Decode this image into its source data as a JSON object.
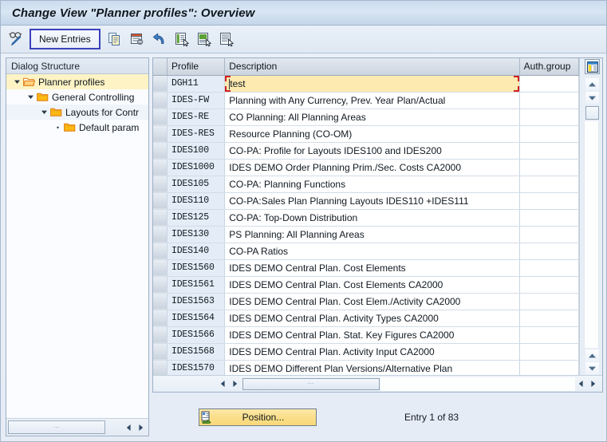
{
  "window": {
    "title": "Change View \"Planner profiles\": Overview"
  },
  "toolbar": {
    "display_change_icon": "glasses-pencil-icon",
    "new_entries_label": "New Entries",
    "buttons": [
      {
        "name": "copy-as-button",
        "icon": "copy-icon"
      },
      {
        "name": "delete-button",
        "icon": "delete-row-icon"
      },
      {
        "name": "undo-button",
        "icon": "undo-icon"
      },
      {
        "name": "select-all-button",
        "icon": "select-all-icon"
      },
      {
        "name": "select-block-button",
        "icon": "select-block-icon"
      },
      {
        "name": "deselect-all-button",
        "icon": "deselect-all-icon"
      }
    ]
  },
  "dialog_structure": {
    "header": "Dialog Structure",
    "items": [
      {
        "label": "Planner profiles",
        "indent": 0,
        "twisty": "down",
        "selected": true
      },
      {
        "label": "General Controlling",
        "indent": 1,
        "twisty": "down",
        "selected": false
      },
      {
        "label": "Layouts for Contr",
        "indent": 2,
        "twisty": "down",
        "selected": false
      },
      {
        "label": "Default param",
        "indent": 3,
        "twisty": "dot",
        "selected": false
      }
    ]
  },
  "table": {
    "columns": [
      "Profile",
      "Description",
      "Auth.group"
    ],
    "rows": [
      {
        "profile": "DGH11",
        "description": "test",
        "auth_group": "",
        "selected": true
      },
      {
        "profile": "IDES-FW",
        "description": "Planning with Any Currency, Prev. Year Plan/Actual",
        "auth_group": "",
        "selected": false
      },
      {
        "profile": "IDES-RE",
        "description": "CO Planning: All Planning Areas",
        "auth_group": "",
        "selected": false
      },
      {
        "profile": "IDES-RES",
        "description": "Resource Planning (CO-OM)",
        "auth_group": "",
        "selected": false
      },
      {
        "profile": "IDES100",
        "description": "CO-PA: Profile for Layouts IDES100 and IDES200",
        "auth_group": "",
        "selected": false
      },
      {
        "profile": "IDES1000",
        "description": "IDES DEMO Order Planning Prim./Sec. Costs   CA2000",
        "auth_group": "",
        "selected": false
      },
      {
        "profile": "IDES105",
        "description": "CO-PA: Planning Functions",
        "auth_group": "",
        "selected": false
      },
      {
        "profile": "IDES110",
        "description": "CO-PA:Sales Plan Planning Layouts IDES110 +IDES111",
        "auth_group": "",
        "selected": false
      },
      {
        "profile": "IDES125",
        "description": "CO-PA: Top-Down Distribution",
        "auth_group": "",
        "selected": false
      },
      {
        "profile": "IDES130",
        "description": "PS Planning: All Planning Areas",
        "auth_group": "",
        "selected": false
      },
      {
        "profile": "IDES140",
        "description": "CO-PA Ratios",
        "auth_group": "",
        "selected": false
      },
      {
        "profile": "IDES1560",
        "description": "IDES DEMO Central Plan. Cost Elements",
        "auth_group": "",
        "selected": false
      },
      {
        "profile": "IDES1561",
        "description": "IDES DEMO Central Plan. Cost Elements      CA2000",
        "auth_group": "",
        "selected": false
      },
      {
        "profile": "IDES1563",
        "description": "IDES DEMO Central Plan. Cost Elem./Activity CA2000",
        "auth_group": "",
        "selected": false
      },
      {
        "profile": "IDES1564",
        "description": "IDES DEMO Central Plan. Activity Types     CA2000",
        "auth_group": "",
        "selected": false
      },
      {
        "profile": "IDES1566",
        "description": "IDES DEMO Central Plan. Stat. Key Figures   CA2000",
        "auth_group": "",
        "selected": false
      },
      {
        "profile": "IDES1568",
        "description": "IDES DEMO Central Plan. Activity Input      CA2000",
        "auth_group": "",
        "selected": false
      },
      {
        "profile": "IDES1570",
        "description": "IDES DEMO Different Plan Versions/Alternative Plan",
        "auth_group": "",
        "selected": false
      }
    ]
  },
  "footer": {
    "position_label": "Position...",
    "entry_status": "Entry 1 of 83"
  },
  "colors": {
    "selection_yellow": "#fdeab0",
    "tree_selection": "#fdf3c4",
    "focus_red": "#d11f1f",
    "new_entries_border": "#3b41bb",
    "profile_column": "#e4edf7",
    "position_button": "#fbdf8a"
  }
}
